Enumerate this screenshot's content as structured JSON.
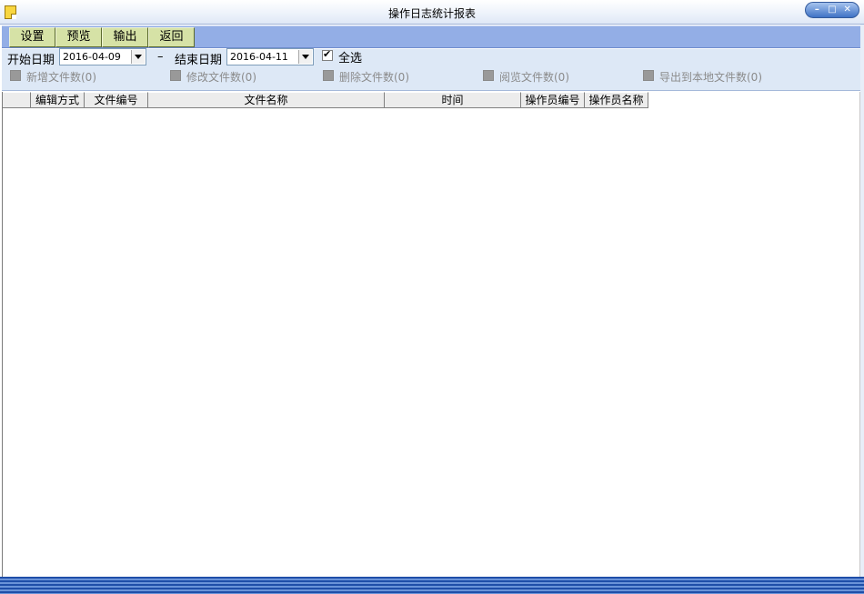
{
  "window": {
    "title": "操作日志统计报表",
    "min": "–",
    "max": "□",
    "close": "✕"
  },
  "toolbar": {
    "buttons": [
      "设置",
      "预览",
      "输出",
      "返回"
    ]
  },
  "filter": {
    "start_label": "开始日期",
    "start_value": "2016-04-09",
    "dash": "–",
    "end_label": "结束日期",
    "end_value": "2016-04-11",
    "select_all": "全选",
    "categories": [
      "新增文件数(0)",
      "修改文件数(0)",
      "删除文件数(0)",
      "阅览文件数(0)",
      "导出到本地文件数(0)"
    ]
  },
  "table": {
    "columns": [
      "",
      "编辑方式",
      "文件编号",
      "文件名称",
      "时间",
      "操作员编号",
      "操作员名称"
    ]
  }
}
